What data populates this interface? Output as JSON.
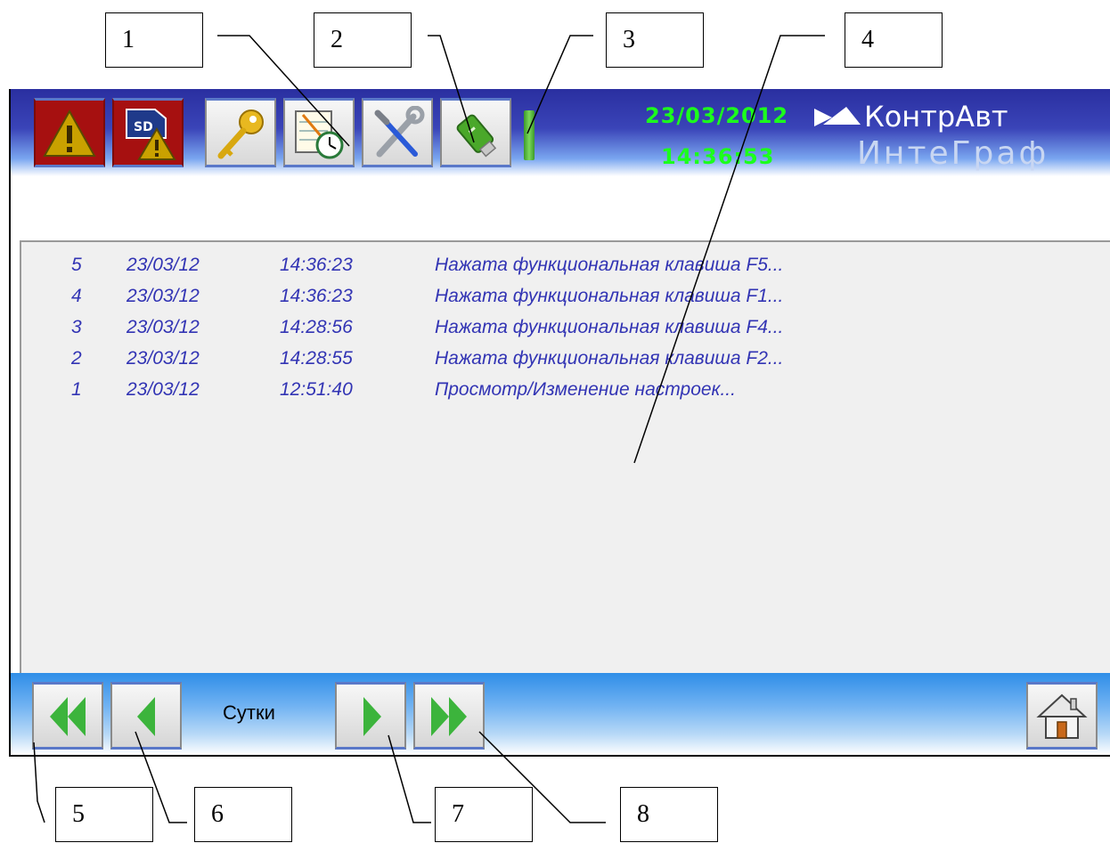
{
  "callouts": [
    "1",
    "2",
    "3",
    "4",
    "5",
    "6",
    "7",
    "8"
  ],
  "header": {
    "date": "23/03/2012",
    "time": "14:36:53",
    "logo_name": "КонтрАвт",
    "logo_sub": "ИнтеГраф"
  },
  "toolbar": {
    "buttons": [
      "alarm-icon",
      "sd-card-warning-icon",
      "key-icon",
      "notepad-clock-icon",
      "tools-icon",
      "usb-drive-icon"
    ]
  },
  "log": {
    "rows": [
      {
        "n": "5",
        "date": "23/03/12",
        "time": "14:36:23",
        "msg": "Нажата функциональная клавиша F5..."
      },
      {
        "n": "4",
        "date": "23/03/12",
        "time": "14:36:23",
        "msg": "Нажата функциональная клавиша F1..."
      },
      {
        "n": "3",
        "date": "23/03/12",
        "time": "14:28:56",
        "msg": "Нажата функциональная клавиша F4..."
      },
      {
        "n": "2",
        "date": "23/03/12",
        "time": "14:28:55",
        "msg": "Нажата функциональная клавиша F2..."
      },
      {
        "n": "1",
        "date": "23/03/12",
        "time": "12:51:40",
        "msg": "Просмотр/Изменение настроек..."
      }
    ]
  },
  "footer": {
    "period_label": "Сутки",
    "buttons": [
      "double-left-arrow-icon",
      "left-arrow-icon",
      "right-arrow-icon",
      "double-right-arrow-icon",
      "home-icon"
    ]
  },
  "colors": {
    "accent_green": "#1cff1c",
    "text_blue": "#3234b4",
    "bar_blue": "#2a2fa0"
  }
}
